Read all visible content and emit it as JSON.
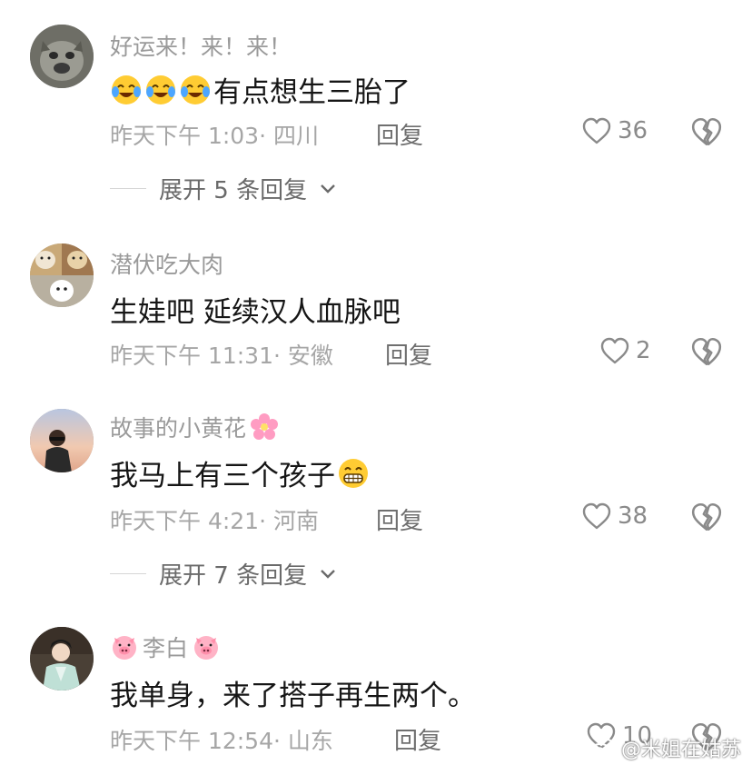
{
  "comments": [
    {
      "username": "好运来！来！来！",
      "content": "有点想生三胎了",
      "content_emojis": [
        "crying-laughing-emoji",
        "crying-laughing-emoji",
        "crying-laughing-emoji"
      ],
      "time": "昨天下午 1:03",
      "location": "四川",
      "reply_label": "回复",
      "likes": "36",
      "expand_label": "展开 5 条回复",
      "avatar": "bulldog-avatar"
    },
    {
      "username": "潜伏吃大肉",
      "content": "生娃吧 延续汉人血脉吧",
      "time": "昨天下午 11:31",
      "location": "安徽",
      "reply_label": "回复",
      "likes": "2",
      "avatar": "dogs-collage-avatar"
    },
    {
      "username": "故事的小黄花",
      "username_emoji": "cherry-blossom-emoji",
      "content": "我马上有三个孩子",
      "content_emoji": "grinning-emoji",
      "time": "昨天下午 4:21",
      "location": "河南",
      "reply_label": "回复",
      "likes": "38",
      "expand_label": "展开 7 条回复",
      "avatar": "sunset-person-avatar"
    },
    {
      "username": "李白",
      "username_emojis": [
        "pig-face-emoji",
        "pig-face-emoji"
      ],
      "content": "我单身，来了搭子再生两个。",
      "time": "昨天下午 12:54",
      "location": "山东",
      "reply_label": "回复",
      "likes": "10",
      "avatar": "ancient-costume-avatar"
    }
  ],
  "watermark": "@米姐在姑苏",
  "colors": {
    "meta": "#a6a6a6",
    "username": "#9a9a9a",
    "content": "#161616",
    "icon": "#8a8a8a"
  }
}
